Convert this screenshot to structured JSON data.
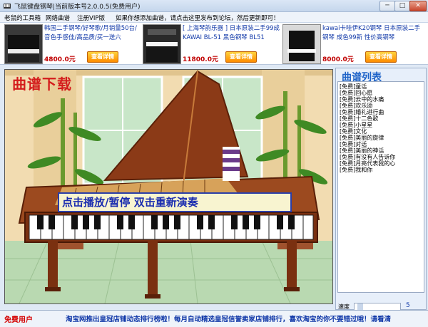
{
  "window": {
    "title": "飞鼠键盘钢琴|当前版本号2.0.0.5(免费用户)",
    "minimize": "─",
    "maximize": "□",
    "close": "✕"
  },
  "menu": {
    "items": [
      "老鼠的工具箱",
      "网络曲谱",
      "注册VIP版"
    ],
    "notice": "如果你想添加曲谱，请点击这里发布到论坛，然后更新即可！"
  },
  "ads": [
    {
      "title": "韩国二手钢琴/好琴歌/月销量50台/音色手感佳/高品质/买一送六",
      "price": "4800.0元",
      "button": "查看详情"
    },
    {
      "title": "[ 上海琴韵乐器 ] 日本原装二手99成 KAWAI BL-51 黑色钢琴 BL51",
      "price": "11800.0元",
      "button": "查看详情"
    },
    {
      "title": "kawai卡哇伊K20钢琴 日本原装二手钢琴 成色99新 性价高钢琴",
      "price": "8000.0元",
      "button": "查看详情"
    }
  ],
  "stage": {
    "download_label": "曲谱下载",
    "play_hint": "点击播放/暂停  双击重新演奏"
  },
  "playlist": {
    "title": "曲谱列表",
    "items": [
      "[免费]童话",
      "[免费]回心愿",
      "[免费]云中的水痛",
      "[免费]欢乐颂",
      "[免费]婚礼进行曲",
      "[免费]十二色歌",
      "[免费]小星星",
      "[免费]文化",
      "[免费]美丽的旋律",
      "[免费]对话",
      "[免费]美丽的神话",
      "[免费]有没有人告诉你",
      "[免费]月亮代表我的心",
      "[免费]我和你"
    ]
  },
  "speed": {
    "label": "速度",
    "value": "5"
  },
  "status": {
    "user": "免费用户",
    "message": "淘宝网推出皇冠店铺动态排行榜啦！每月自动精选皇冠信誉卖家店铺排行，喜欢淘宝的你不要错过哦！请看清"
  },
  "colors": {
    "accent": "#1e63c8",
    "button_orange": "#ff8c00",
    "price_red": "#c00000",
    "wall": "#f2dcb1",
    "piano_wood": "#8b3a17"
  }
}
